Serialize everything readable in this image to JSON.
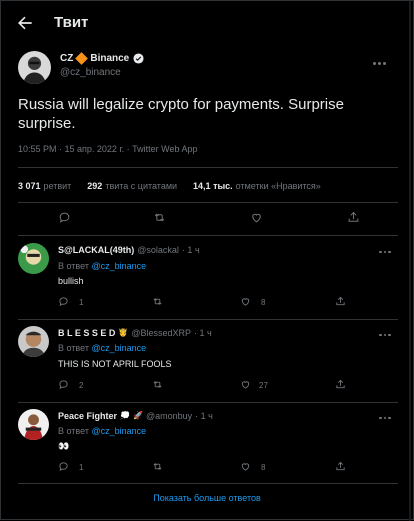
{
  "header": {
    "title": "Твит"
  },
  "tweet": {
    "author_name": "CZ",
    "author_brand": "Binance",
    "author_handle": "@cz_binance",
    "text": "Russia will legalize crypto for payments. Surprise surprise.",
    "meta": "10:55 PM · 15 апр. 2022 г. · Twitter Web App",
    "stats": {
      "retweets": "3 071",
      "retweets_label": "ретвит",
      "quotes": "292",
      "quotes_label": "твита с цитатами",
      "likes": "14,1 тыс.",
      "likes_label": "отметки «Нравится»"
    },
    "brand_color": "#f7931a"
  },
  "replies": [
    {
      "name": "S@LACKAL(49th)",
      "handle": "@solackal",
      "time": "· 1 ч",
      "in_reply_prefix": "В ответ",
      "in_reply_to": "@cz_binance",
      "text": "bullish",
      "reply_count": "1",
      "retweet_count": "",
      "like_count": "8"
    },
    {
      "name": "B L E S S E D",
      "handle": "@BlessedXRP",
      "time": "· 1 ч",
      "in_reply_prefix": "В ответ",
      "in_reply_to": "@cz_binance",
      "text": "THIS IS NOT APRIL FOOLS",
      "reply_count": "2",
      "retweet_count": "",
      "like_count": "27"
    },
    {
      "name": "Peace Fighter",
      "handle": "@amonbuy",
      "time": "· 1 ч",
      "in_reply_prefix": "В ответ",
      "in_reply_to": "@cz_binance",
      "text": "👀",
      "reply_count": "1",
      "retweet_count": "",
      "like_count": "8"
    }
  ],
  "show_more": "Показать больше ответов",
  "colors": {
    "accent": "#1d9bf0",
    "muted": "#71767b",
    "border": "#2f3336"
  }
}
